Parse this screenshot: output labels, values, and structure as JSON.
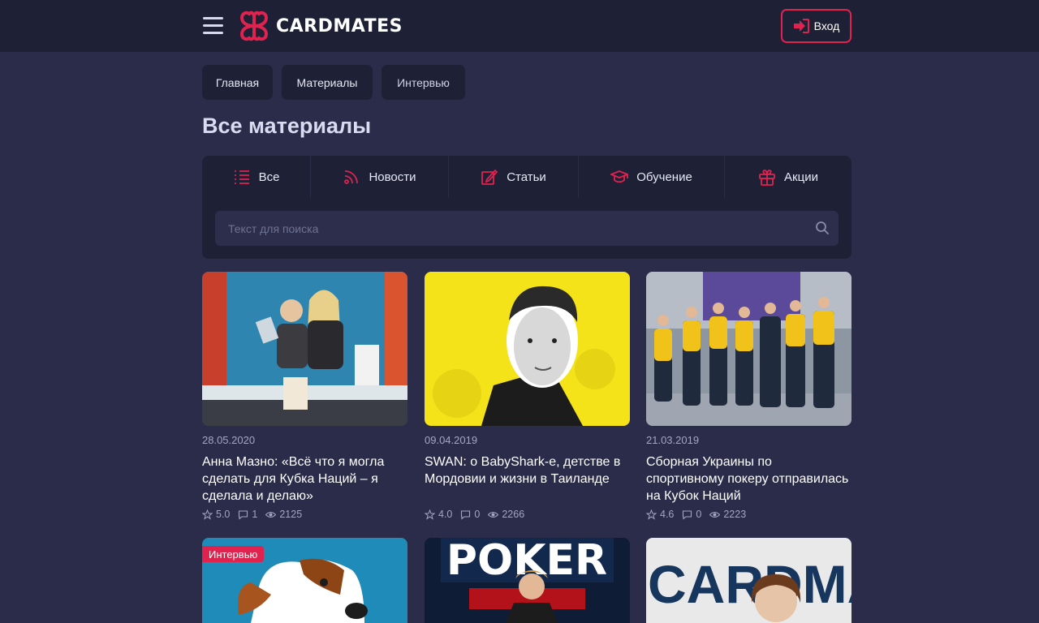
{
  "header": {
    "logo_text": "CARDMATES",
    "login_label": "Вход"
  },
  "breadcrumbs": [
    {
      "label": "Главная"
    },
    {
      "label": "Материалы"
    },
    {
      "label": "Интервью"
    }
  ],
  "page_title": "Все материалы",
  "filters": {
    "tabs": [
      {
        "label": "Все",
        "icon": "list-icon"
      },
      {
        "label": "Новости",
        "icon": "rss-icon"
      },
      {
        "label": "Статьи",
        "icon": "edit-icon"
      },
      {
        "label": "Обучение",
        "icon": "graduation-cap-icon"
      },
      {
        "label": "Акции",
        "icon": "gift-icon"
      }
    ],
    "search_placeholder": "Текст для поиска"
  },
  "articles": [
    {
      "date": "28.05.2020",
      "title": "Анна Мазно: «Всё что я могла сделать для Кубка Наций – я сделала и делаю»",
      "rating": "5.0",
      "comments": "1",
      "views": "2125"
    },
    {
      "date": "09.04.2019",
      "title": "SWAN: о BabyShark-е, детстве в Мордовии и жизни в Таиланде",
      "rating": "4.0",
      "comments": "0",
      "views": "2266"
    },
    {
      "date": "21.03.2019",
      "title": "Сборная Украины по спортивному покеру отправилась на Кубок Наций",
      "rating": "4.6",
      "comments": "0",
      "views": "2223"
    },
    {
      "tag": "Интервью"
    },
    {
      "image_text": "POKER"
    },
    {
      "image_text": "CARDMAT"
    }
  ],
  "colors": {
    "accent": "#e0224f",
    "background": "#2a2c4a",
    "panel": "#1e2036"
  }
}
